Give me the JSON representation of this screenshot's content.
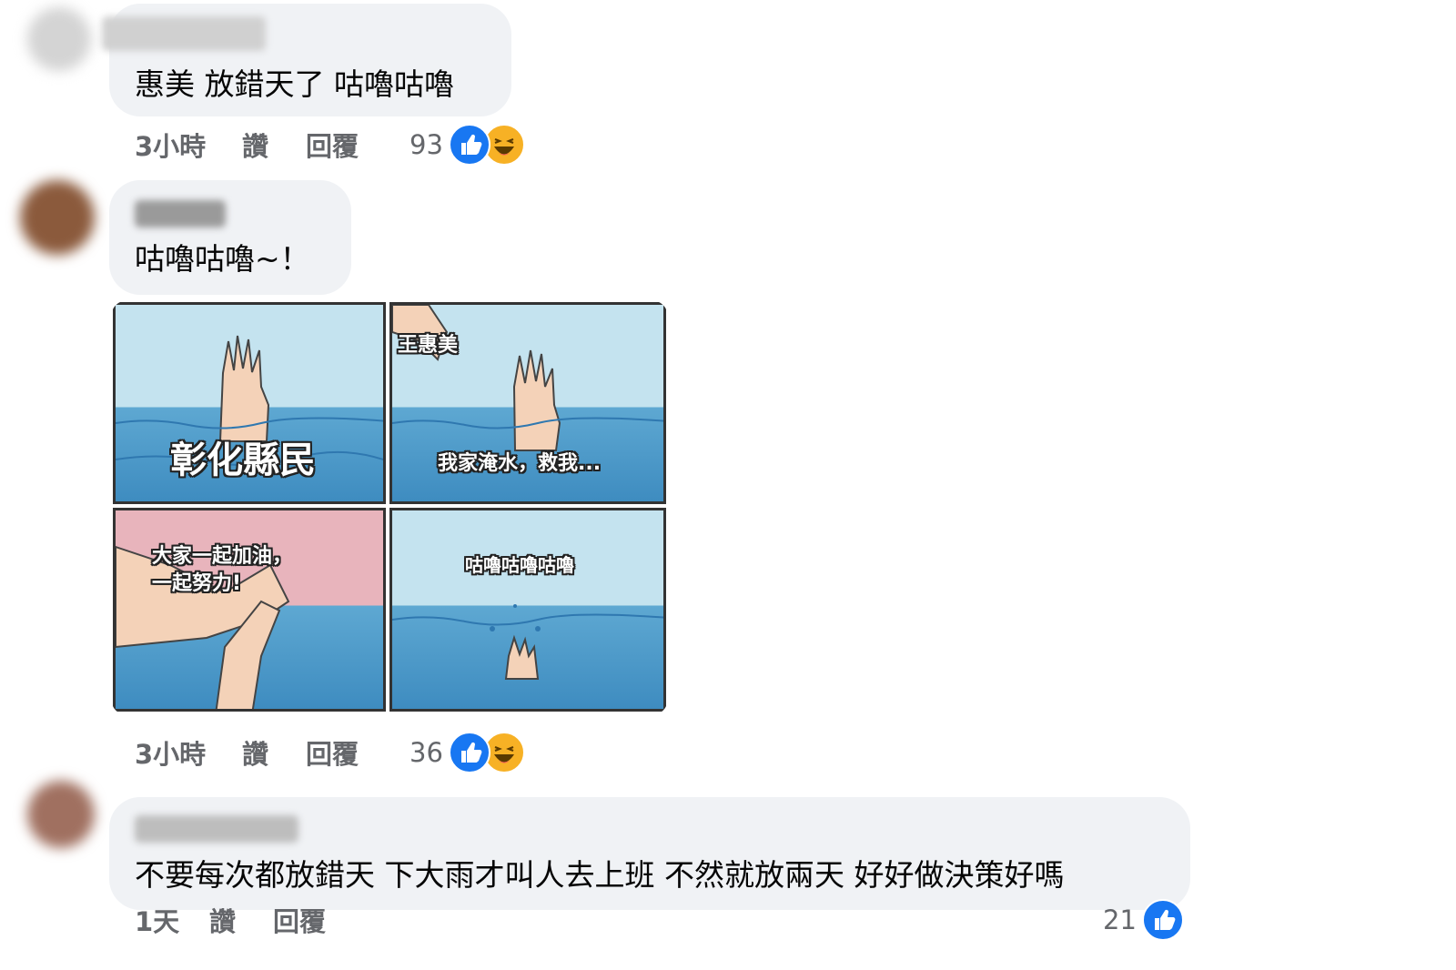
{
  "comments": [
    {
      "text": "惠美 放錯天了 咕嚕咕嚕",
      "time": "3小時",
      "like_label": "讚",
      "reply_label": "回覆",
      "reaction_count": "93",
      "reactions": [
        "like-icon",
        "haha-icon"
      ]
    },
    {
      "text": "咕嚕咕嚕~！",
      "time": "3小時",
      "like_label": "讚",
      "reply_label": "回覆",
      "reaction_count": "36",
      "reactions": [
        "like-icon",
        "haha-icon"
      ],
      "meme": {
        "panel1_caption": "彰化縣民",
        "panel2_caption_top": "王惠美",
        "panel2_caption_bottom": "我家淹水，救我...",
        "panel3_caption_line1": "大家一起加油，",
        "panel3_caption_line2": "一起努力!",
        "panel4_caption": "咕嚕咕嚕咕嚕"
      }
    },
    {
      "text": "不要每次都放錯天 下大雨才叫人去上班 不然就放兩天 好好做決策好嗎",
      "time": "1天",
      "like_label": "讚",
      "reply_label": "回覆",
      "reaction_count": "21",
      "reactions": [
        "like-icon"
      ]
    }
  ],
  "colors": {
    "bubble": "#f0f2f5",
    "meta_text": "#65676b",
    "like_blue": "#1877f2",
    "haha_yellow": "#f7b125"
  }
}
